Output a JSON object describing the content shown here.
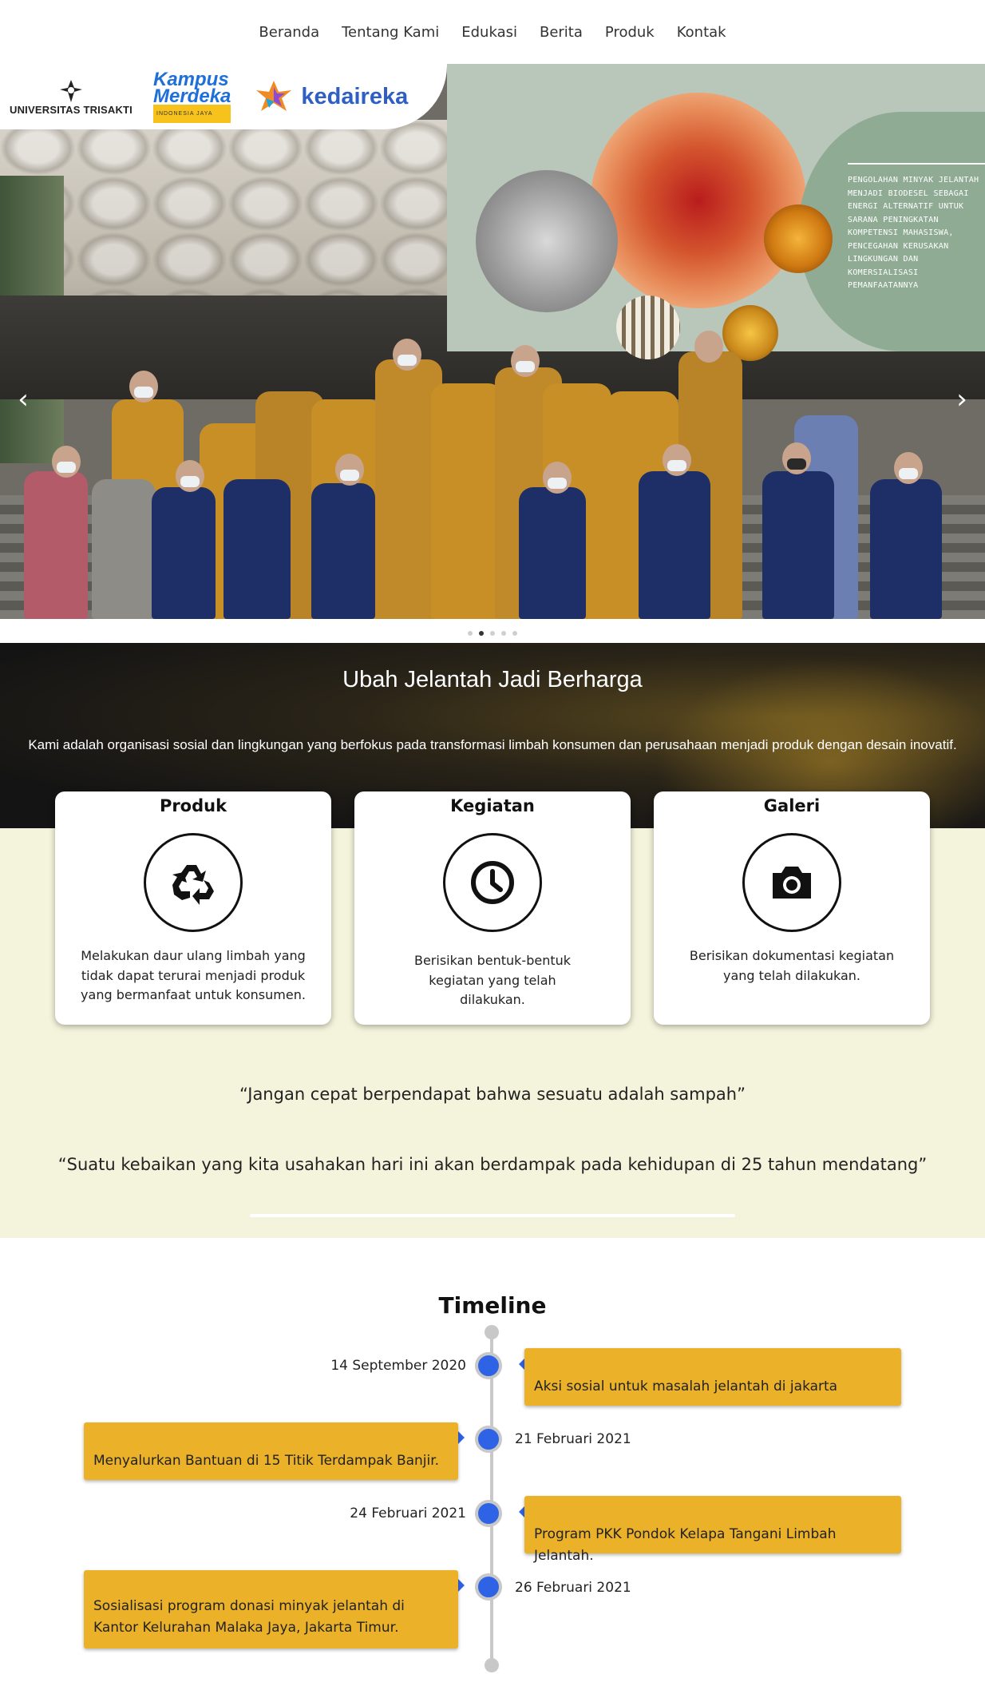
{
  "nav": {
    "items": [
      "Beranda",
      "Tentang Kami",
      "Edukasi",
      "Berita",
      "Produk",
      "Kontak"
    ]
  },
  "hero": {
    "logos": {
      "trisakti": "UNIVERSITAS TRISAKTI",
      "kampus_line1": "Kampus",
      "kampus_line2": "Merdeka",
      "kampus_sub": "INDONESIA JAYA",
      "kedaireka": "kedaireka"
    },
    "tagline": "PENGOLAHAN MINYAK JELANTAH MENJADI BIODESEL SEBAGAI ENERGI ALTERNATIF UNTUK SARANA PENINGKATAN KOMPETENSI MAHASISWA, PENCEGAHAN KERUSAKAN LINGKUNGAN DAN KOMERSIALISASI PEMANFAATANNYA",
    "prev_icon": "chevron-left-icon",
    "next_icon": "chevron-right-icon",
    "slide_count": 5,
    "active_slide": 2
  },
  "intro": {
    "title": "Ubah Jelantah Jadi Berharga",
    "description": "Kami adalah organisasi sosial dan lingkungan yang berfokus pada transformasi limbah konsumen dan perusahaan menjadi produk dengan desain inovatif."
  },
  "cards": [
    {
      "title": "Produk",
      "icon": "recycle-icon",
      "text": "Melakukan daur ulang limbah yang tidak dapat terurai menjadi produk yang bermanfaat untuk konsumen."
    },
    {
      "title": "Kegiatan",
      "icon": "clock-icon",
      "text": "Berisikan bentuk-bentuk kegiatan yang telah dilakukan."
    },
    {
      "title": "Galeri",
      "icon": "camera-icon",
      "text": "Berisikan dokumentasi kegiatan yang telah dilakukan."
    }
  ],
  "quotes": [
    "“Jangan cepat berpendapat bahwa sesuatu adalah sampah”",
    "“Suatu kebaikan yang kita usahakan hari ini akan berdampak pada kehidupan di 25 tahun mendatang”"
  ],
  "timeline": {
    "title": "Timeline",
    "events": [
      {
        "date": "14 September 2020",
        "text": "Aksi sosial untuk masalah jelantah di jakarta"
      },
      {
        "date": "21 Februari 2021",
        "text": "Menyalurkan Bantuan di 15 Titik Terdampak Banjir."
      },
      {
        "date": "24 Februari 2021",
        "text": "Program PKK Pondok Kelapa Tangani Limbah Jelantah."
      },
      {
        "date": "26 Februari 2021",
        "text": "Sosialisasi program donasi minyak jelantah di Kantor Kelurahan Malaka Jaya, Jakarta Timur."
      }
    ]
  },
  "colors": {
    "accent_blue": "#2f63e6",
    "timeline_box": "#ebb229",
    "cream_bg": "#f4f4dc"
  }
}
